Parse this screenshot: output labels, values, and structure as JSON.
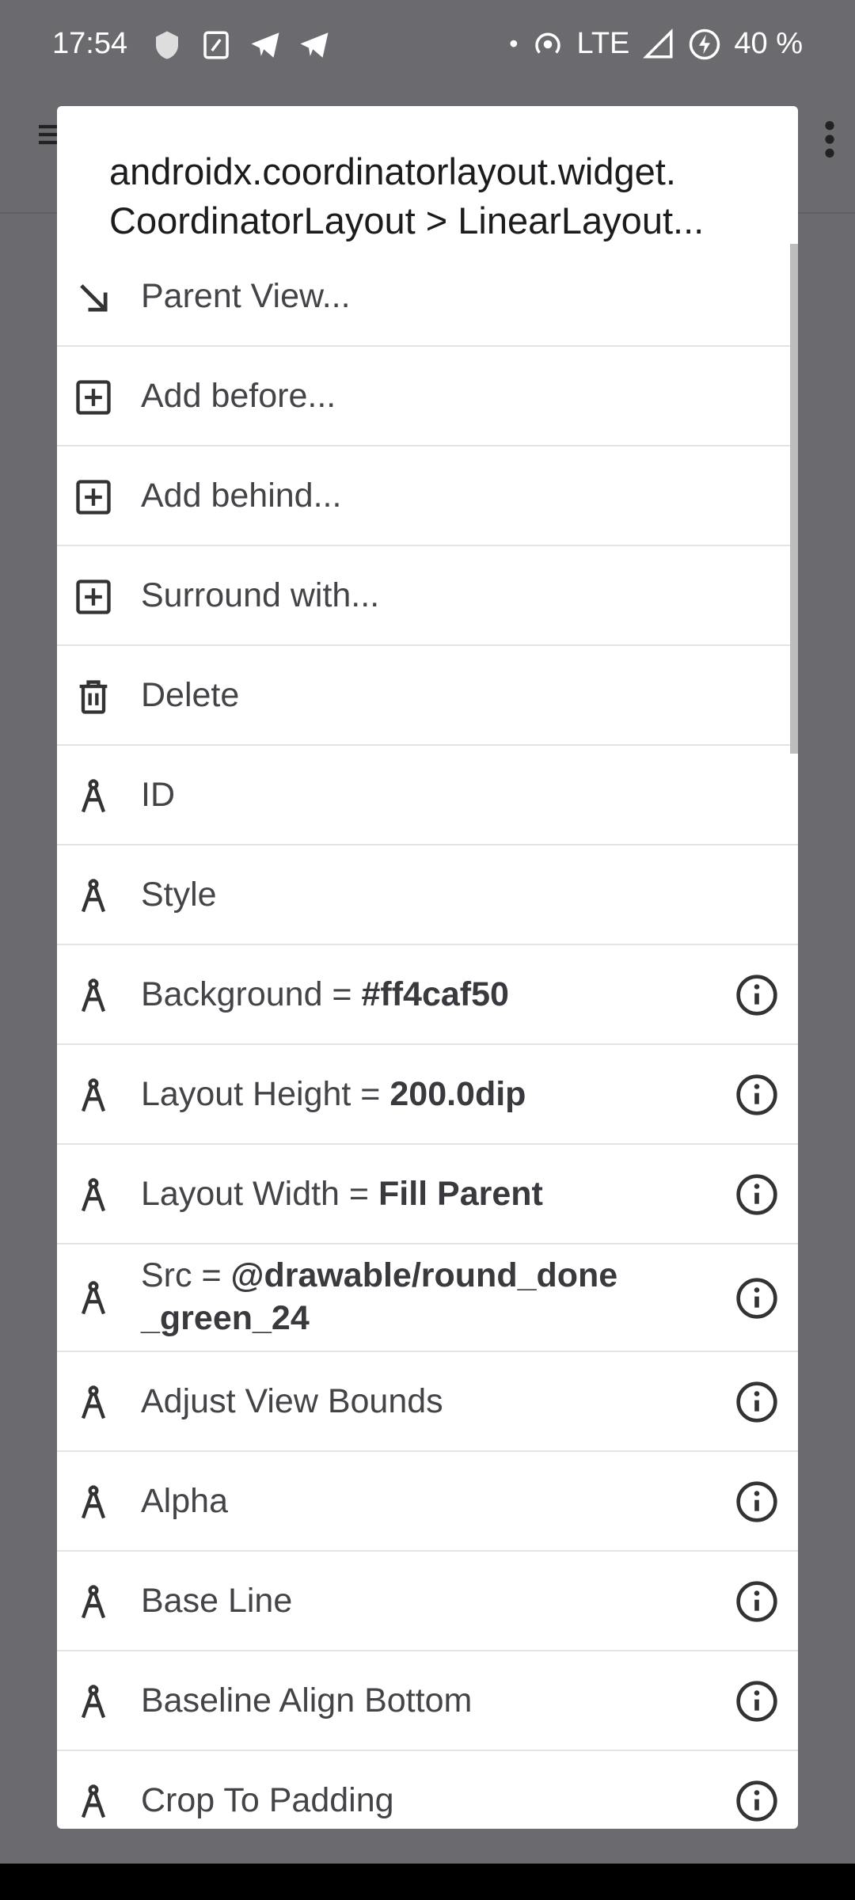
{
  "status_bar": {
    "time": "17:54",
    "network": "LTE",
    "battery": "40 %",
    "dot": "•"
  },
  "dialog": {
    "title_line1": "androidx.coordinatorlayout.widget.",
    "title_line2": "CoordinatorLayout > LinearLayout..."
  },
  "items": [
    {
      "label": "Parent View...",
      "icon": "arrow-down-right-icon"
    },
    {
      "label": "Add before...",
      "icon": "add-box-icon"
    },
    {
      "label": "Add behind...",
      "icon": "add-box-icon"
    },
    {
      "label": "Surround with...",
      "icon": "add-box-icon"
    },
    {
      "label": "Delete",
      "icon": "trash-icon"
    },
    {
      "label": "ID",
      "icon": "compass-icon"
    },
    {
      "label": "Style",
      "icon": "compass-icon"
    },
    {
      "label": "Background = ",
      "value": "#ff4caf50",
      "icon": "compass-icon",
      "info": true
    },
    {
      "label": "Layout Height = ",
      "value": "200.0dip",
      "icon": "compass-icon",
      "info": true
    },
    {
      "label": "Layout Width = ",
      "value": "Fill Parent",
      "icon": "compass-icon",
      "info": true
    },
    {
      "label": "Src = ",
      "value": "@drawable/round_done",
      "value2": "_green_24",
      "icon": "compass-icon",
      "info": true
    },
    {
      "label": "Adjust View Bounds",
      "icon": "compass-icon",
      "info": true
    },
    {
      "label": "Alpha",
      "icon": "compass-icon",
      "info": true
    },
    {
      "label": "Base Line",
      "icon": "compass-icon",
      "info": true
    },
    {
      "label": "Baseline Align Bottom",
      "icon": "compass-icon",
      "info": true
    },
    {
      "label": "Crop To Padding",
      "icon": "compass-icon",
      "info": true
    }
  ]
}
